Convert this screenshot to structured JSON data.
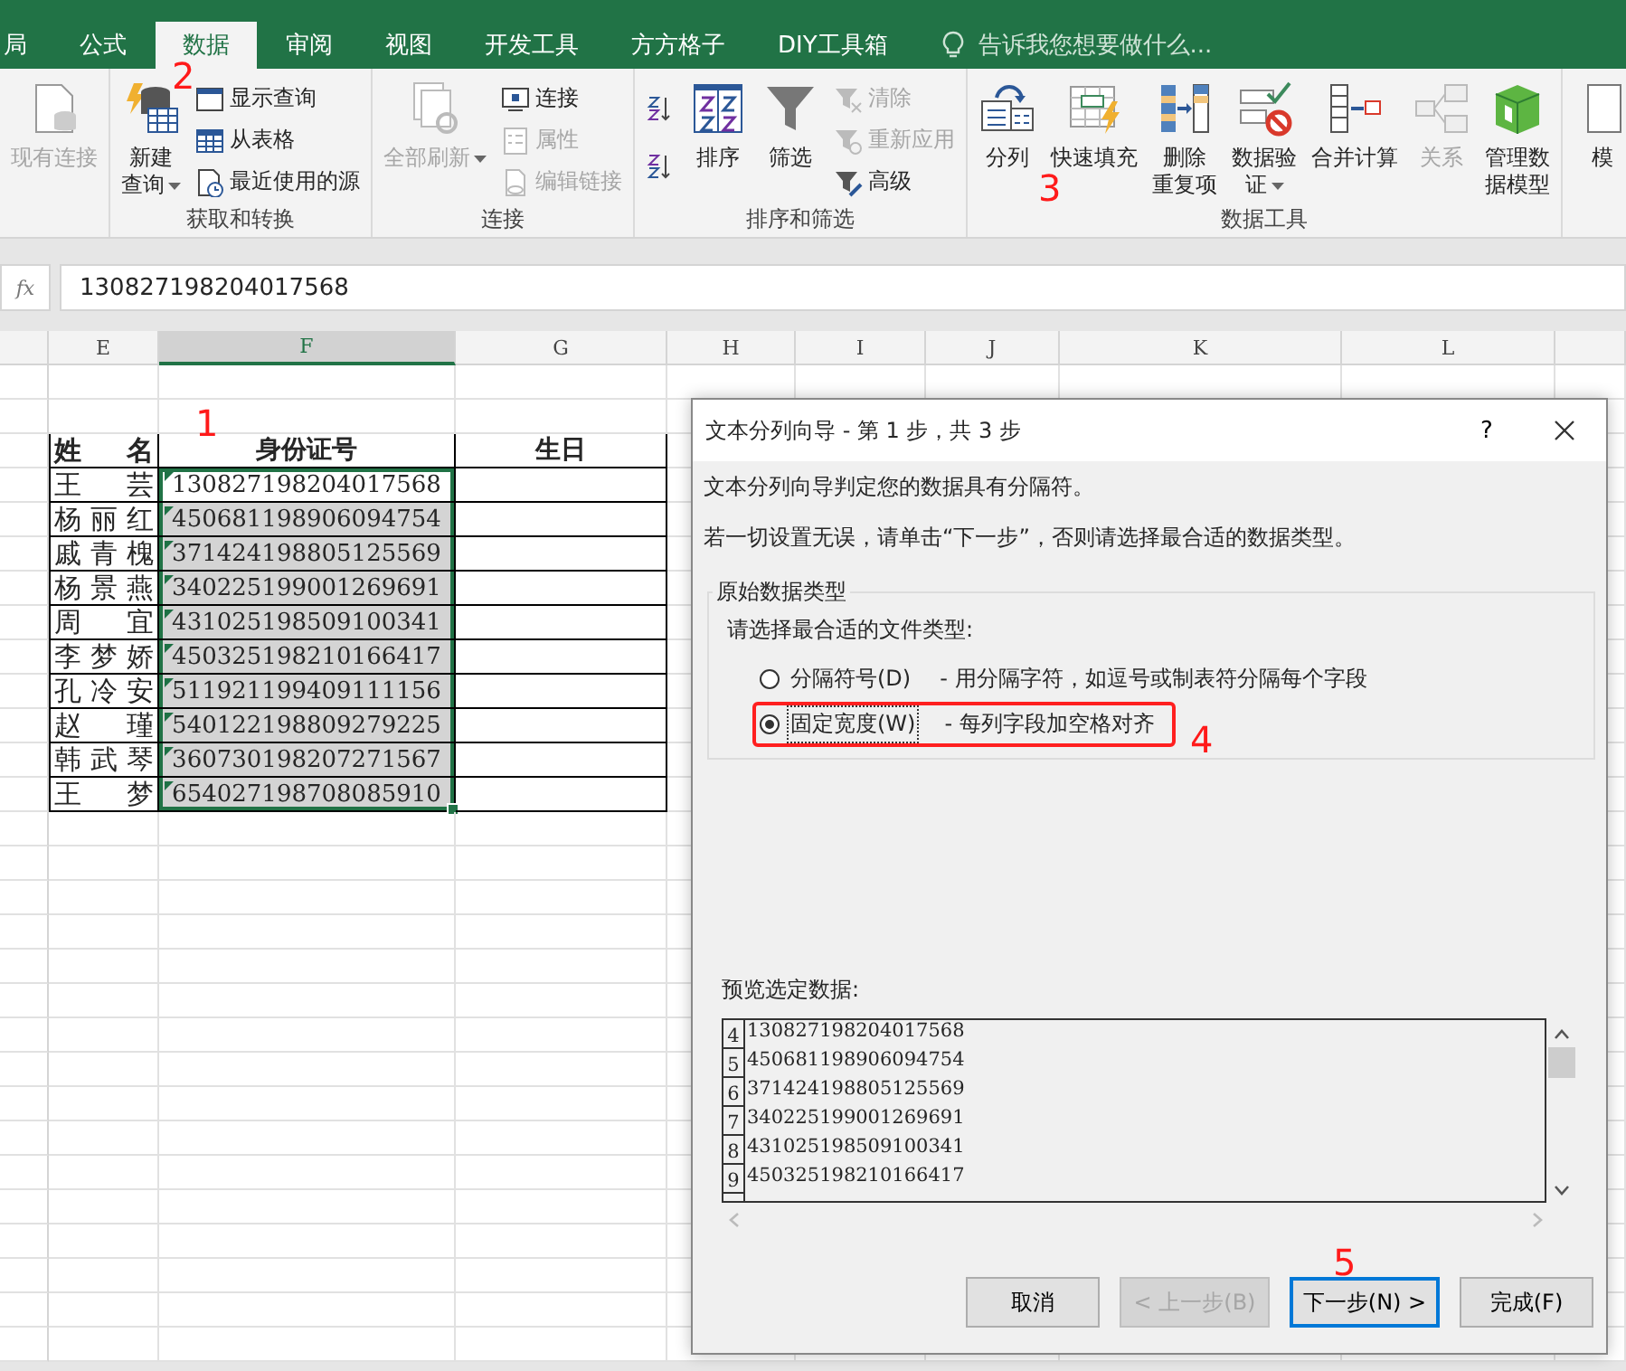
{
  "ribbon_tabs": [
    {
      "label": "局",
      "selected": false
    },
    {
      "label": "公式",
      "selected": false
    },
    {
      "label": "数据",
      "selected": true
    },
    {
      "label": "审阅",
      "selected": false
    },
    {
      "label": "视图",
      "selected": false
    },
    {
      "label": "开发工具",
      "selected": false
    },
    {
      "label": "方方格子",
      "selected": false
    },
    {
      "label": "DIY工具箱",
      "selected": false
    }
  ],
  "tell_me": {
    "placeholder": "告诉我您想要做什么..."
  },
  "ribbon_groups": [
    {
      "commands": [
        {
          "label": "现有连接",
          "kind": "large",
          "disabled": true
        }
      ]
    },
    {
      "label": "获取和转换",
      "commands": [
        {
          "label_lines": [
            "新建",
            "查询"
          ],
          "kind": "large",
          "disabled": false,
          "menu": true
        },
        {
          "label": "显示查询",
          "kind": "small",
          "disabled": false
        },
        {
          "label": "从表格",
          "kind": "small",
          "disabled": false
        },
        {
          "label": "最近使用的源",
          "kind": "small",
          "disabled": false
        }
      ]
    },
    {
      "label": "连接",
      "commands": [
        {
          "label": "全部刷新",
          "kind": "large",
          "disabled": true,
          "menu": true
        },
        {
          "label": "连接",
          "kind": "small",
          "disabled": false
        },
        {
          "label": "属性",
          "kind": "small",
          "disabled": true
        },
        {
          "label": "编辑链接",
          "kind": "small",
          "disabled": true
        }
      ]
    },
    {
      "label": "排序和筛选",
      "commands": [
        {
          "kind": "icon",
          "disabled": false
        },
        {
          "kind": "icon",
          "disabled": false
        },
        {
          "label": "排序",
          "kind": "large",
          "disabled": false
        },
        {
          "label": "筛选",
          "kind": "large",
          "disabled": false
        },
        {
          "label": "清除",
          "kind": "small",
          "disabled": true
        },
        {
          "label": "重新应用",
          "kind": "small",
          "disabled": true
        },
        {
          "label": "高级",
          "kind": "small",
          "disabled": false
        }
      ]
    },
    {
      "label": "数据工具",
      "commands": [
        {
          "label": "分列",
          "kind": "large",
          "disabled": false
        },
        {
          "label": "快速填充",
          "kind": "large",
          "disabled": false
        },
        {
          "label_lines": [
            "删除",
            "重复项"
          ],
          "kind": "large",
          "disabled": false
        },
        {
          "label_lines": [
            "数据验",
            "证"
          ],
          "kind": "large",
          "disabled": false,
          "menu": true
        },
        {
          "label": "合并计算",
          "kind": "large",
          "disabled": false
        },
        {
          "label": "关系",
          "kind": "large",
          "disabled": true
        },
        {
          "label_lines": [
            "管理数",
            "据模型"
          ],
          "kind": "large",
          "disabled": false
        }
      ]
    },
    {
      "commands": [
        {
          "label": "模",
          "kind": "large",
          "disabled": false
        }
      ]
    }
  ],
  "formula_bar": {
    "function_label": "fx",
    "value": "130827198204017568"
  },
  "columns": [
    {
      "label": "E",
      "selected": false
    },
    {
      "label": "F",
      "selected": true
    },
    {
      "label": "G",
      "selected": false
    },
    {
      "label": "H",
      "selected": false
    },
    {
      "label": "I",
      "selected": false
    },
    {
      "label": "J",
      "selected": false
    },
    {
      "label": "K",
      "selected": false
    },
    {
      "label": "L",
      "selected": false
    }
  ],
  "table": {
    "headers": [
      "姓名",
      "身份证号",
      "生日"
    ],
    "rows": [
      {
        "name": "王芸",
        "id": "130827198204017568",
        "selected": true,
        "active": true,
        "warning": true
      },
      {
        "name": "杨丽红",
        "id": "450681198906094754",
        "selected": true,
        "active": false,
        "warning": true
      },
      {
        "name": "戚青槐",
        "id": "371424198805125569",
        "selected": true,
        "active": false,
        "warning": true
      },
      {
        "name": "杨景燕",
        "id": "340225199001269691",
        "selected": true,
        "active": false,
        "warning": true
      },
      {
        "name": "周宜",
        "id": "431025198509100341",
        "selected": true,
        "active": false,
        "warning": true
      },
      {
        "name": "李梦娇",
        "id": "450325198210166417",
        "selected": true,
        "active": false,
        "warning": true
      },
      {
        "name": "孔冷安",
        "id": "511921199409111156",
        "selected": true,
        "active": false,
        "warning": true
      },
      {
        "name": "赵瑾",
        "id": "540122198809279225",
        "selected": true,
        "active": false,
        "warning": true
      },
      {
        "name": "韩武琴",
        "id": "360730198207271567",
        "selected": true,
        "active": false,
        "warning": true
      },
      {
        "name": "王梦",
        "id": "654027198708085910",
        "selected": true,
        "active": false,
        "warning": true
      }
    ]
  },
  "dialog": {
    "title": "文本分列向导 - 第 1 步，共 3 步",
    "help": "?",
    "intro": "文本分列向导判定您的数据具有分隔符。",
    "hint": "若一切设置无误，请单击“下一步”，否则请选择最合适的数据类型。",
    "group_title": "原始数据类型",
    "prompt": "请选择最合适的文件类型:",
    "options": [
      {
        "label": "分隔符号(D)",
        "description": "- 用分隔字符，如逗号或制表符分隔每个字段",
        "selected": false
      },
      {
        "label": "固定宽度(W)",
        "description": "- 每列字段加空格对齐",
        "selected": true
      }
    ],
    "preview_label": "预览选定数据:",
    "preview_rows": [
      {
        "row": "4",
        "text": "130827198204017568"
      },
      {
        "row": "5",
        "text": "450681198906094754"
      },
      {
        "row": "6",
        "text": "371424198805125569"
      },
      {
        "row": "7",
        "text": "340225199001269691"
      },
      {
        "row": "8",
        "text": "431025198509100341"
      },
      {
        "row": "9",
        "text": "450325198210166417"
      }
    ],
    "buttons": [
      {
        "label": "取消",
        "disabled": false,
        "focused": false
      },
      {
        "label": "< 上一步(B)",
        "disabled": true,
        "focused": false
      },
      {
        "label": "下一步(N) >",
        "disabled": false,
        "focused": true
      },
      {
        "label": "完成(F)",
        "disabled": false,
        "focused": false
      }
    ]
  },
  "annotations": [
    "1",
    "2",
    "3",
    "4",
    "5"
  ]
}
